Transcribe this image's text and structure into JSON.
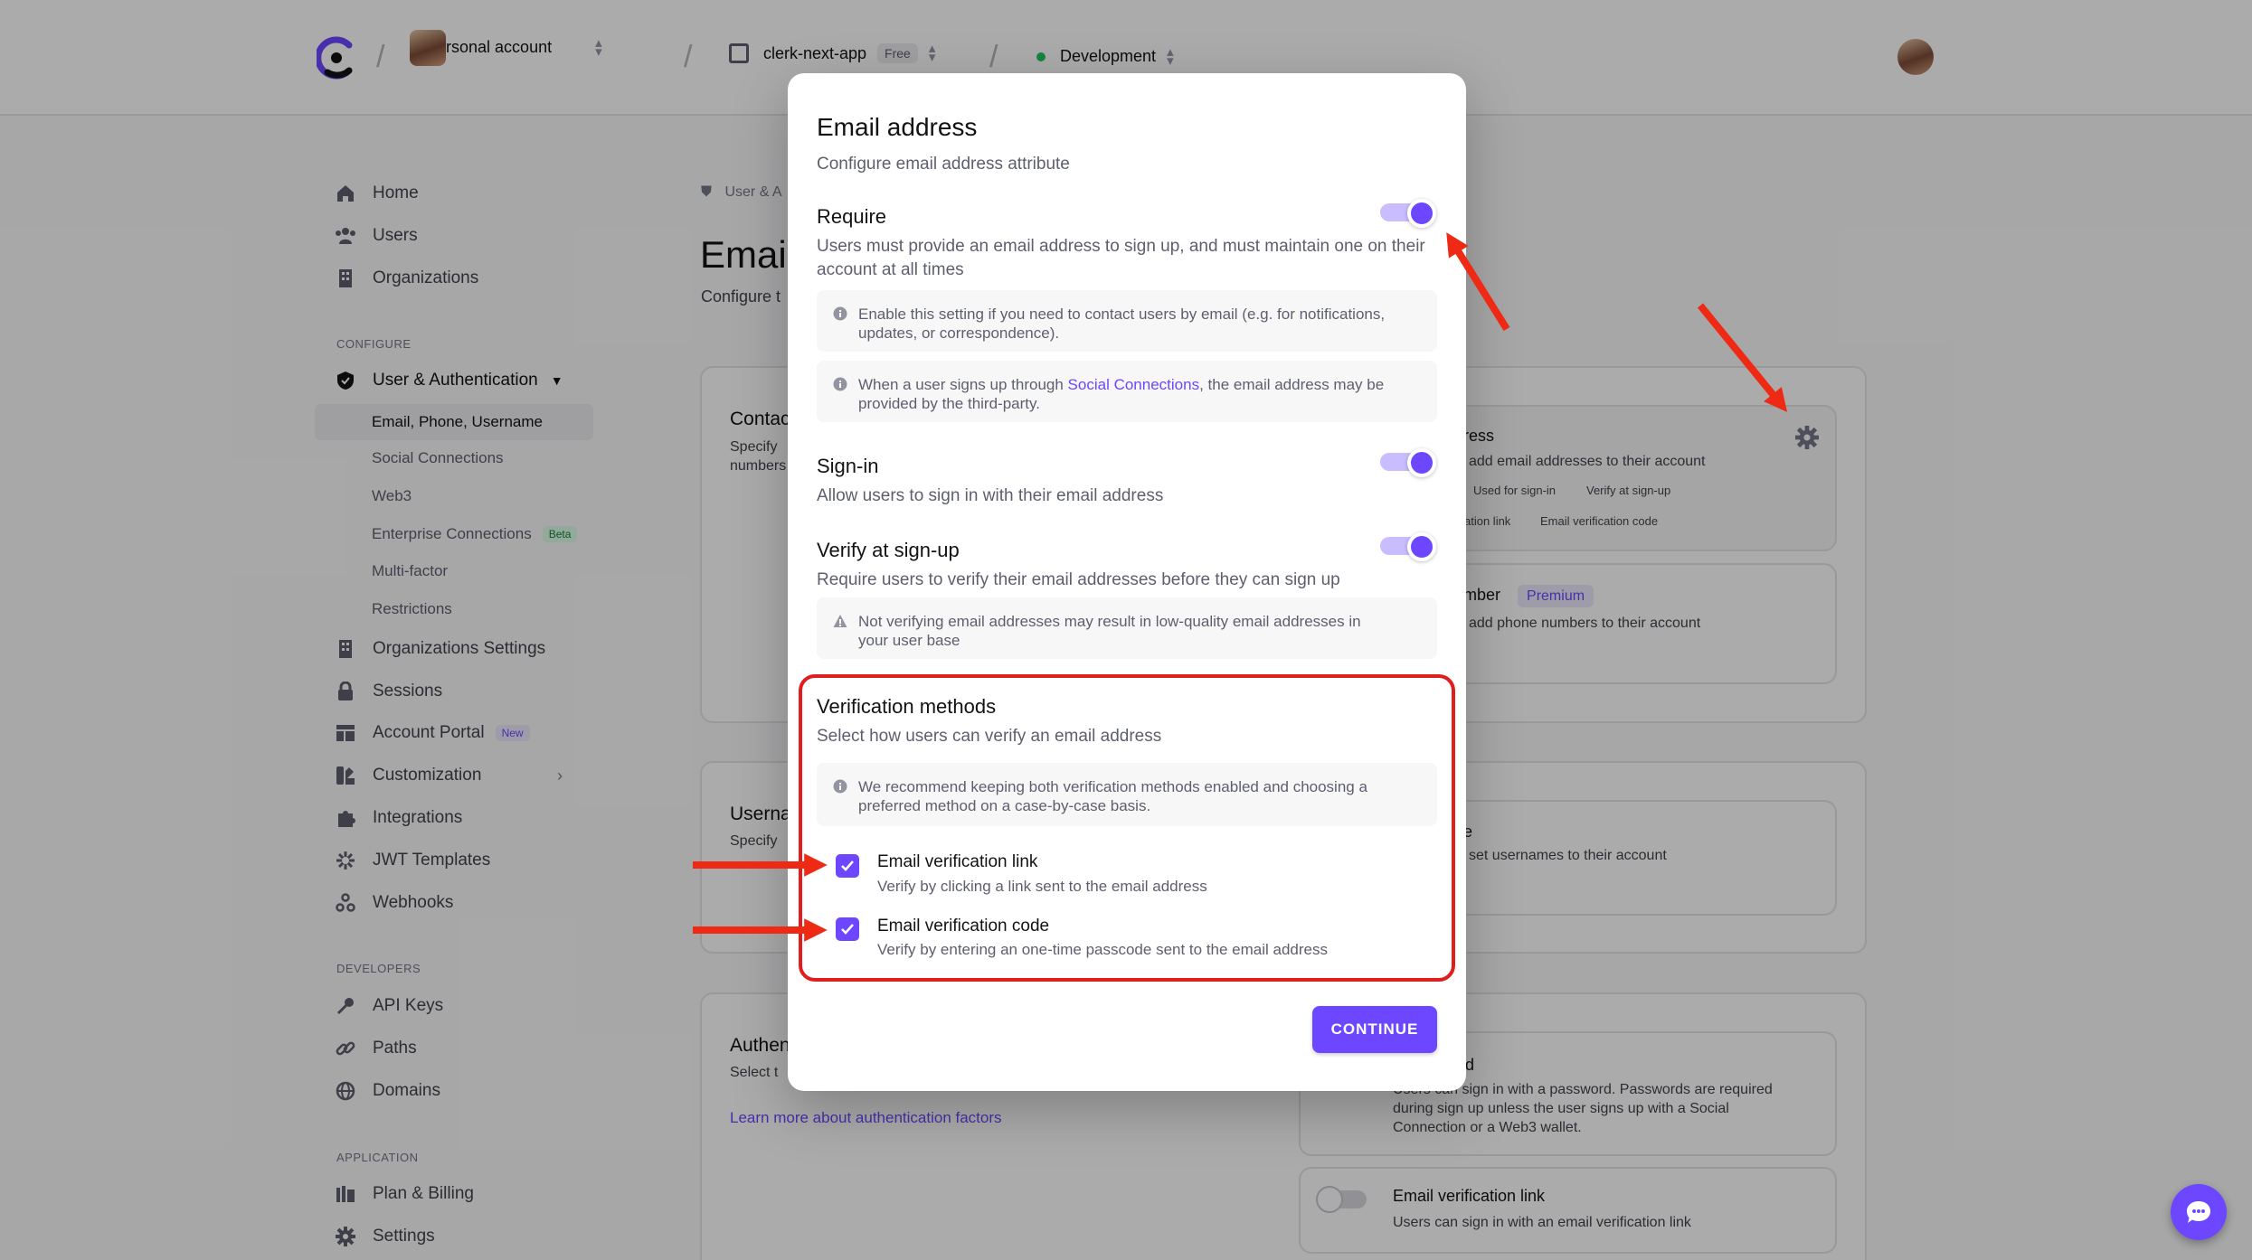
{
  "topbar": {
    "account": "Personal account",
    "app": "clerk-next-app",
    "app_plan": "Free",
    "environment": "Development"
  },
  "sidebar": {
    "items_top": [
      {
        "label": "Home",
        "icon": "home-icon"
      },
      {
        "label": "Users",
        "icon": "users-icon"
      },
      {
        "label": "Organizations",
        "icon": "building-icon"
      }
    ],
    "configure_heading": "CONFIGURE",
    "user_auth": "User & Authentication",
    "sub_items": [
      "Email, Phone, Username",
      "Social Connections",
      "Web3",
      "Enterprise Connections",
      "Multi-factor",
      "Restrictions"
    ],
    "enterprise_badge": "Beta",
    "items_configure": [
      {
        "label": "Organizations Settings",
        "icon": "building-icon"
      },
      {
        "label": "Sessions",
        "icon": "lock-icon"
      },
      {
        "label": "Account Portal",
        "icon": "portal-icon"
      },
      {
        "label": "Customization",
        "icon": "brush-icon"
      },
      {
        "label": "Integrations",
        "icon": "puzzle-icon"
      },
      {
        "label": "JWT Templates",
        "icon": "jwt-icon"
      },
      {
        "label": "Webhooks",
        "icon": "webhook-icon"
      }
    ],
    "account_portal_badge": "New",
    "developers_heading": "DEVELOPERS",
    "items_dev": [
      {
        "label": "API Keys",
        "icon": "key-icon"
      },
      {
        "label": "Paths",
        "icon": "link-icon"
      },
      {
        "label": "Domains",
        "icon": "globe-icon"
      }
    ],
    "application_heading": "APPLICATION",
    "items_app": [
      {
        "label": "Plan & Billing",
        "icon": "billing-icon"
      },
      {
        "label": "Settings",
        "icon": "gear-icon"
      }
    ]
  },
  "background": {
    "breadcrumb": "User & A",
    "page_title": "Emai",
    "page_sub": "Configure t",
    "contact_title": "Contac",
    "contact_desc_1": "Specify",
    "contact_desc_2": "numbers",
    "email_card_title": "ress",
    "email_card_desc": "add email addresses to their account",
    "email_tags": [
      "Used for sign-in",
      "Verify at sign-up",
      "ation link",
      "Email verification code"
    ],
    "phone_title": "mber",
    "phone_badge": "Premium",
    "phone_desc": "add phone numbers to their account",
    "username_section_title": "Userna",
    "username_section_desc": "Specify",
    "username_card_title": "e",
    "username_card_desc": "set usernames to their account",
    "auth_section_title": "Authen",
    "auth_section_desc": "Select t",
    "auth_link": "Learn more about authentication factors",
    "password_title": "d",
    "password_desc": [
      "Users can sign in with a password. Passwords are required",
      "during sign up unless the user signs up with a Social",
      "Connection or a Web3 wallet."
    ],
    "email_link_title": "Email verification link",
    "email_link_desc": "Users can sign in with an email verification link"
  },
  "modal": {
    "title": "Email address",
    "subtitle": "Configure email address attribute",
    "require": {
      "title": "Require",
      "desc_1": "Users must provide an email address to sign up, and must maintain one on their",
      "desc_2": "account at all times",
      "note_1a": "Enable this setting if you need to contact users by email (e.g. for notifications,",
      "note_1b": "updates, or correspondence).",
      "note_2a": "When a user signs up through",
      "note_2_link": "Social Connections",
      "note_2b": ", the email address may be",
      "note_2c": "provided by the third-party.",
      "enabled": true
    },
    "signin": {
      "title": "Sign-in",
      "desc": "Allow users to sign in with their email address",
      "enabled": true
    },
    "verify": {
      "title": "Verify at sign-up",
      "desc": "Require users to verify their email addresses before they can sign up",
      "warning_a": "Not verifying email addresses may result in low-quality email addresses in",
      "warning_b": "your user base",
      "enabled": true
    },
    "methods": {
      "title": "Verification methods",
      "desc": "Select how users can verify an email address",
      "note_a": "We recommend keeping both verification methods enabled and choosing a",
      "note_b": "preferred method on a case-by-case basis.",
      "options": [
        {
          "label": "Email verification link",
          "desc": "Verify by clicking a link sent to the email address",
          "checked": true
        },
        {
          "label": "Email verification code",
          "desc": "Verify by entering an one-time passcode sent to the email address",
          "checked": true
        }
      ]
    },
    "continue_label": "CONTINUE"
  },
  "colors": {
    "accent": "#6c47ff",
    "annotation": "#e11d1d"
  }
}
